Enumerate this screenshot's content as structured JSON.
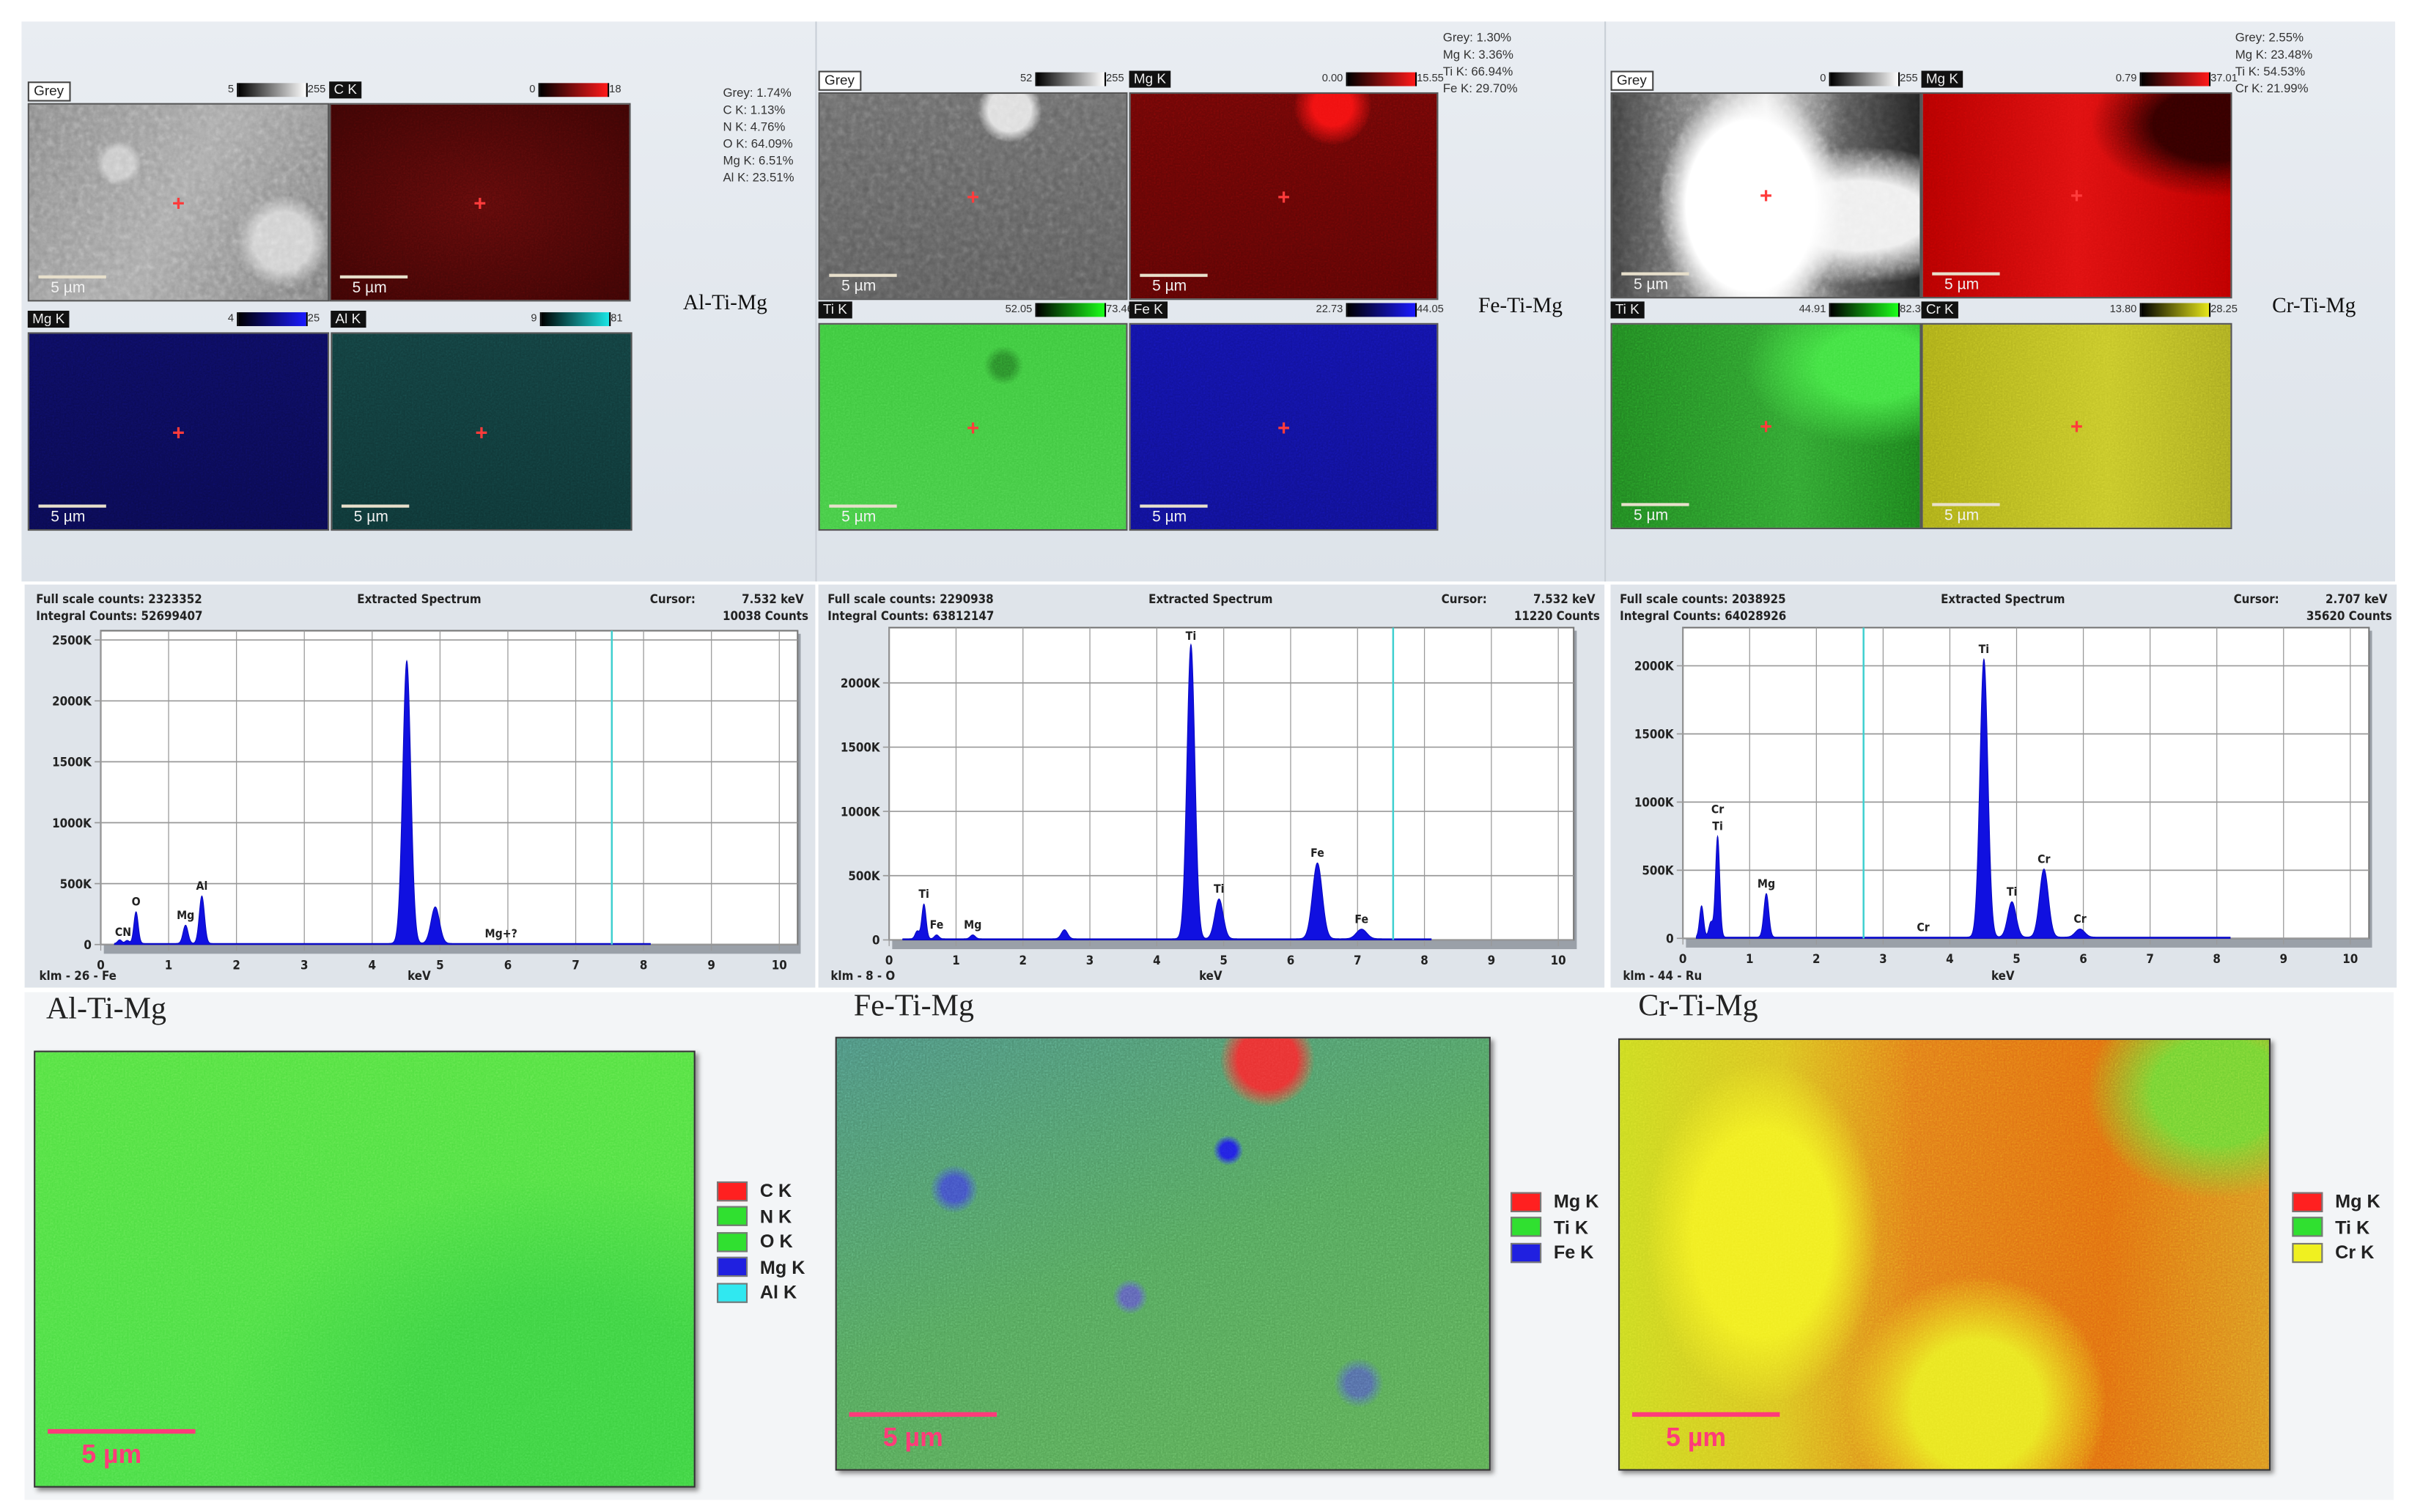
{
  "samples": [
    {
      "name": "Al-Ti-Mg",
      "composition": [
        "Grey: 1.74%",
        "C K: 1.13%",
        "N K: 4.76%",
        "O K: 64.09%",
        "Mg K: 6.51%",
        "Al K: 23.51%"
      ],
      "maps": [
        {
          "label": "Grey",
          "min": "5",
          "max": "255",
          "color": "#ffffff"
        },
        {
          "label": "C K",
          "min": "0",
          "max": "18",
          "color": "#ff1a1a"
        },
        {
          "label": "Mg K",
          "min": "4",
          "max": "25",
          "color": "#1a1aff"
        },
        {
          "label": "Al K",
          "min": "9",
          "max": "81",
          "color": "#1ae6e6"
        }
      ],
      "scale_bar": "5 µm",
      "overlay": {
        "title": "Al-Ti-Mg",
        "scale_bar": "5 µm",
        "legend": [
          {
            "label": "C K",
            "color": "#ff2020"
          },
          {
            "label": "N K",
            "color": "#30e030"
          },
          {
            "label": "O K",
            "color": "#30e030"
          },
          {
            "label": "Mg K",
            "color": "#2020e0"
          },
          {
            "label": "Al K",
            "color": "#30e8f0"
          }
        ]
      }
    },
    {
      "name": "Fe-Ti-Mg",
      "composition": [
        "Grey: 1.30%",
        "Mg K: 3.36%",
        "Ti K: 66.94%",
        "Fe K: 29.70%"
      ],
      "maps": [
        {
          "label": "Grey",
          "min": "52",
          "max": "255",
          "color": "#ffffff"
        },
        {
          "label": "Mg K",
          "min": "0.00",
          "max": "15.55",
          "color": "#ff1a1a"
        },
        {
          "label": "Ti K",
          "min": "52.05",
          "max": "73.46",
          "color": "#1aff1a"
        },
        {
          "label": "Fe K",
          "min": "22.73",
          "max": "44.05",
          "color": "#1a1aff"
        }
      ],
      "scale_bar": "5 µm",
      "overlay": {
        "title": "Fe-Ti-Mg",
        "scale_bar": "5 µm",
        "legend": [
          {
            "label": "Mg K",
            "color": "#ff2020"
          },
          {
            "label": "Ti K",
            "color": "#30e030"
          },
          {
            "label": "Fe K",
            "color": "#2020e0"
          }
        ]
      }
    },
    {
      "name": "Cr-Ti-Mg",
      "composition": [
        "Grey: 2.55%",
        "Mg K: 23.48%",
        "Ti K: 54.53%",
        "Cr K: 21.99%"
      ],
      "maps": [
        {
          "label": "Grey",
          "min": "0",
          "max": "255",
          "color": "#ffffff"
        },
        {
          "label": "Mg K",
          "min": "0.79",
          "max": "37.01",
          "color": "#ff1a1a"
        },
        {
          "label": "Ti K",
          "min": "44.91",
          "max": "82.30",
          "color": "#1aff1a"
        },
        {
          "label": "Cr K",
          "min": "13.80",
          "max": "28.25",
          "color": "#e6e61a"
        }
      ],
      "scale_bar": "5 µm",
      "overlay": {
        "title": "Cr-Ti-Mg",
        "scale_bar": "5 µm",
        "legend": [
          {
            "label": "Mg K",
            "color": "#ff2020"
          },
          {
            "label": "Ti K",
            "color": "#30e030"
          },
          {
            "label": "Cr K",
            "color": "#f0f020"
          }
        ]
      }
    }
  ],
  "chart_data": [
    {
      "type": "area",
      "title": "Extracted Spectrum",
      "full_scale_counts": "Full scale counts: 2323352",
      "integral_counts": "Integral Counts: 52699407",
      "cursor_label": "Cursor:",
      "cursor_kev": "7.532 keV",
      "cursor_counts": "10038 Counts",
      "cursor_value": 7.532,
      "xlabel": "keV",
      "footer": "klm - 26 - Fe",
      "xlim": [
        0,
        10.27
      ],
      "ylim": [
        0,
        2576000
      ],
      "xticks": [
        0,
        1,
        2,
        3,
        4,
        5,
        6,
        7,
        8,
        9,
        10
      ],
      "yticks": [
        {
          "v": 0,
          "t": "0"
        },
        {
          "v": 500000,
          "t": "500K"
        },
        {
          "v": 1000000,
          "t": "1000K"
        },
        {
          "v": 1500000,
          "t": "1500K"
        },
        {
          "v": 2000000,
          "t": "2000K"
        },
        {
          "v": 2500000,
          "t": "2500K"
        }
      ],
      "data_end_kev": 8.1,
      "peaks": [
        {
          "kev": 0.28,
          "counts": 30000
        },
        {
          "kev": 0.39,
          "counts": 25000
        },
        {
          "kev": 0.52,
          "counts": 260000
        },
        {
          "kev": 1.25,
          "counts": 150000
        },
        {
          "kev": 1.49,
          "counts": 390000
        },
        {
          "kev": 4.51,
          "counts": 2320000
        },
        {
          "kev": 4.93,
          "counts": 300000
        }
      ],
      "labels": [
        {
          "text": "CN",
          "kev": 0.33
        },
        {
          "text": "O",
          "kev": 0.52
        },
        {
          "text": "Mg",
          "kev": 1.25
        },
        {
          "text": "Al",
          "kev": 1.49
        },
        {
          "text": "Mg+?",
          "kev": 5.9
        }
      ]
    },
    {
      "type": "area",
      "title": "Extracted Spectrum",
      "full_scale_counts": "Full scale counts: 2290938",
      "integral_counts": "Integral Counts: 63812147",
      "cursor_label": "Cursor:",
      "cursor_kev": "7.532 keV",
      "cursor_counts": "11220 Counts",
      "cursor_value": 7.532,
      "xlabel": "keV",
      "footer": "klm - 8 - O",
      "xlim": [
        0,
        10.23
      ],
      "ylim": [
        0,
        2430000
      ],
      "xticks": [
        0,
        1,
        2,
        3,
        4,
        5,
        6,
        7,
        8,
        9,
        10
      ],
      "yticks": [
        {
          "v": 0,
          "t": "0"
        },
        {
          "v": 500000,
          "t": "500K"
        },
        {
          "v": 1000000,
          "t": "1000K"
        },
        {
          "v": 1500000,
          "t": "1500K"
        },
        {
          "v": 2000000,
          "t": "2000K"
        }
      ],
      "data_end_kev": 8.1,
      "peaks": [
        {
          "kev": 0.42,
          "counts": 60000
        },
        {
          "kev": 0.52,
          "counts": 270000
        },
        {
          "kev": 0.71,
          "counts": 30000
        },
        {
          "kev": 1.25,
          "counts": 30000
        },
        {
          "kev": 2.62,
          "counts": 70000
        },
        {
          "kev": 4.51,
          "counts": 2290000
        },
        {
          "kev": 4.93,
          "counts": 310000
        },
        {
          "kev": 6.4,
          "counts": 590000
        },
        {
          "kev": 7.06,
          "counts": 75000
        }
      ],
      "labels": [
        {
          "text": "Ti",
          "kev": 0.52
        },
        {
          "text": "Fe",
          "kev": 0.71
        },
        {
          "text": "Mg",
          "kev": 1.25
        },
        {
          "text": "Ti",
          "kev": 4.51
        },
        {
          "text": "Ti",
          "kev": 4.93
        },
        {
          "text": "Fe",
          "kev": 6.4
        },
        {
          "text": "Fe",
          "kev": 7.06
        }
      ]
    },
    {
      "type": "area",
      "title": "Extracted Spectrum",
      "full_scale_counts": "Full scale counts: 2038925",
      "integral_counts": "Integral Counts: 64028926",
      "cursor_label": "Cursor:",
      "cursor_kev": "2.707 keV",
      "cursor_counts": "35620 Counts",
      "cursor_value": 2.707,
      "xlabel": "keV",
      "footer": "klm - 44 - Ru",
      "xlim": [
        0,
        10.28
      ],
      "ylim": [
        0,
        2280000
      ],
      "xticks": [
        0,
        1,
        2,
        3,
        4,
        5,
        6,
        7,
        8,
        9,
        10
      ],
      "yticks": [
        {
          "v": 0,
          "t": "0"
        },
        {
          "v": 500000,
          "t": "500K"
        },
        {
          "v": 1000000,
          "t": "1000K"
        },
        {
          "v": 1500000,
          "t": "1500K"
        },
        {
          "v": 2000000,
          "t": "2000K"
        }
      ],
      "data_end_kev": 8.2,
      "peaks": [
        {
          "kev": 0.28,
          "counts": 230000
        },
        {
          "kev": 0.42,
          "counts": 110000
        },
        {
          "kev": 0.52,
          "counts": 740000
        },
        {
          "kev": 1.25,
          "counts": 320000
        },
        {
          "kev": 4.51,
          "counts": 2040000
        },
        {
          "kev": 4.93,
          "counts": 260000
        },
        {
          "kev": 5.41,
          "counts": 500000
        },
        {
          "kev": 5.95,
          "counts": 60000
        }
      ],
      "labels": [
        {
          "text": "Ti",
          "kev": 0.52
        },
        {
          "text": "Cr",
          "kev": 0.52
        },
        {
          "text": "Mg",
          "kev": 1.25
        },
        {
          "text": "Cr",
          "kev": 3.6
        },
        {
          "text": "Ti",
          "kev": 4.51
        },
        {
          "text": "Ti",
          "kev": 4.93
        },
        {
          "text": "Cr",
          "kev": 5.41
        },
        {
          "text": "Cr",
          "kev": 5.95
        }
      ]
    }
  ]
}
